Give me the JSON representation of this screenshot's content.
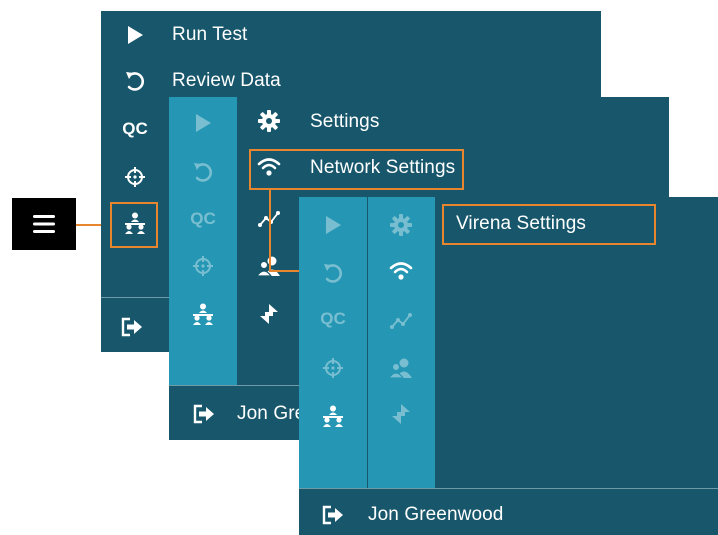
{
  "panel1": {
    "menu": [
      {
        "label": "Run Test",
        "icon": "play-icon"
      },
      {
        "label": "Review Data",
        "icon": "undo-icon"
      }
    ],
    "rail_icons": [
      "qc-icon",
      "crosshair-icon",
      "network-icon"
    ],
    "qc_label": "QC",
    "footer_icon": "logout-icon"
  },
  "panel2": {
    "menu": [
      {
        "label": "Settings",
        "icon": "gear-icon"
      },
      {
        "label": "Network Settings",
        "icon": "wifi-icon"
      }
    ],
    "qc_label": "QC",
    "footer_label": "Jon Gre",
    "footer_icon": "logout-icon"
  },
  "panel3": {
    "menu": [
      {
        "label": "Virena Settings"
      }
    ],
    "qc_label": "QC",
    "footer_label": "Jon Greenwood",
    "footer_icon": "logout-icon"
  },
  "hamburger_icon": "menu-icon",
  "colors": {
    "panel": "#17566b",
    "rail": "#2597b4",
    "highlight": "#e8852f",
    "text": "#ffffff"
  }
}
